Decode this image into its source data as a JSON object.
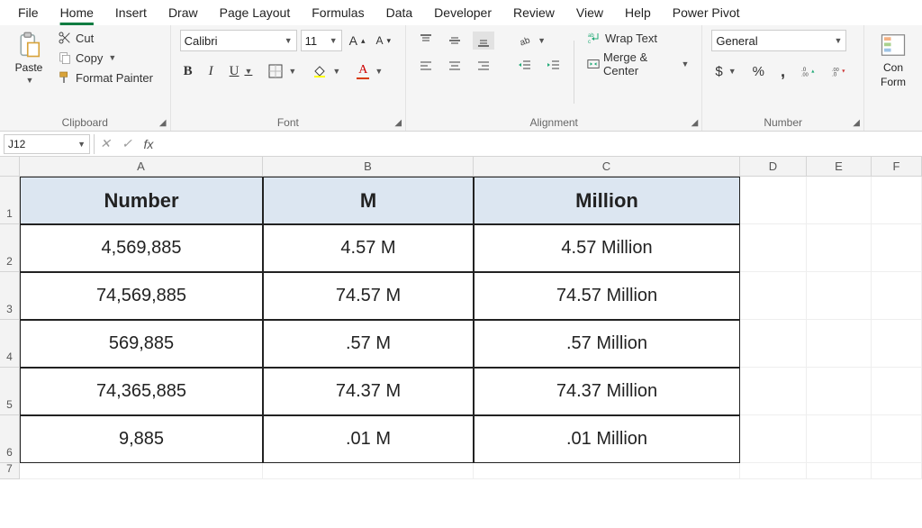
{
  "menu": {
    "items": [
      "File",
      "Home",
      "Insert",
      "Draw",
      "Page Layout",
      "Formulas",
      "Data",
      "Developer",
      "Review",
      "View",
      "Help",
      "Power Pivot"
    ],
    "active": "Home"
  },
  "ribbon": {
    "clipboard": {
      "label": "Clipboard",
      "paste": "Paste",
      "cut": "Cut",
      "copy": "Copy",
      "format_painter": "Format Painter"
    },
    "font": {
      "label": "Font",
      "font_name": "Calibri",
      "font_size": "11",
      "bold": "B",
      "italic": "I",
      "underline": "U"
    },
    "alignment": {
      "label": "Alignment",
      "wrap": "Wrap Text",
      "merge": "Merge & Center"
    },
    "number": {
      "label": "Number",
      "format": "General",
      "currency": "$",
      "percent": "%",
      "comma": ","
    },
    "cond": {
      "label1": "Con",
      "label2": "Form"
    }
  },
  "formula_bar": {
    "name_box": "J12",
    "cancel": "✕",
    "enter": "✓",
    "fx": "fx",
    "value": ""
  },
  "columns": [
    "A",
    "B",
    "C",
    "D",
    "E",
    "F"
  ],
  "rows": [
    "1",
    "2",
    "3",
    "4",
    "5",
    "6",
    "7"
  ],
  "sheet": {
    "headers": [
      "Number",
      "M",
      "Million"
    ],
    "data": [
      [
        "4,569,885",
        "4.57 M",
        "4.57 Million"
      ],
      [
        "74,569,885",
        "74.57 M",
        "74.57 Million"
      ],
      [
        "569,885",
        ".57 M",
        ".57 Million"
      ],
      [
        "74,365,885",
        "74.37 M",
        "74.37 Million"
      ],
      [
        "9,885",
        ".01 M",
        ".01 Million"
      ]
    ]
  }
}
